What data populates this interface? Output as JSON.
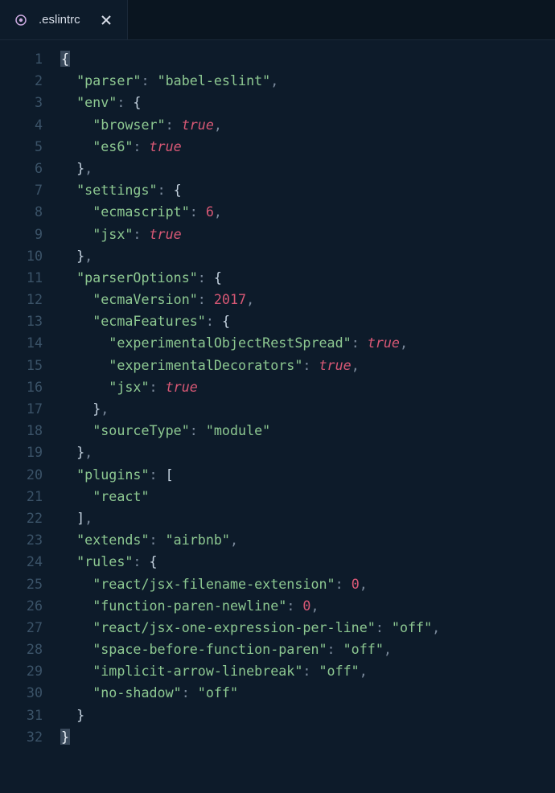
{
  "tab": {
    "filename": ".eslintrc",
    "iconColor": "#d8b8e8"
  },
  "lineNumbers": [
    1,
    2,
    3,
    4,
    5,
    6,
    7,
    8,
    9,
    10,
    11,
    12,
    13,
    14,
    15,
    16,
    17,
    18,
    19,
    20,
    21,
    22,
    23,
    24,
    25,
    26,
    27,
    28,
    29,
    30,
    31,
    32
  ],
  "code": {
    "lines": [
      [
        {
          "t": "brace",
          "v": "{",
          "hl": true
        }
      ],
      [
        {
          "t": "indent",
          "v": "  "
        },
        {
          "t": "key",
          "v": "\"parser\""
        },
        {
          "t": "punc",
          "v": ": "
        },
        {
          "t": "str",
          "v": "\"babel-eslint\""
        },
        {
          "t": "punc",
          "v": ","
        }
      ],
      [
        {
          "t": "indent",
          "v": "  "
        },
        {
          "t": "key",
          "v": "\"env\""
        },
        {
          "t": "punc",
          "v": ": "
        },
        {
          "t": "brace",
          "v": "{"
        }
      ],
      [
        {
          "t": "indent",
          "v": "    "
        },
        {
          "t": "key",
          "v": "\"browser\""
        },
        {
          "t": "punc",
          "v": ": "
        },
        {
          "t": "bool",
          "v": "true"
        },
        {
          "t": "punc",
          "v": ","
        }
      ],
      [
        {
          "t": "indent",
          "v": "    "
        },
        {
          "t": "key",
          "v": "\"es6\""
        },
        {
          "t": "punc",
          "v": ": "
        },
        {
          "t": "bool",
          "v": "true"
        }
      ],
      [
        {
          "t": "indent",
          "v": "  "
        },
        {
          "t": "brace",
          "v": "}"
        },
        {
          "t": "punc",
          "v": ","
        }
      ],
      [
        {
          "t": "indent",
          "v": "  "
        },
        {
          "t": "key",
          "v": "\"settings\""
        },
        {
          "t": "punc",
          "v": ": "
        },
        {
          "t": "brace",
          "v": "{"
        }
      ],
      [
        {
          "t": "indent",
          "v": "    "
        },
        {
          "t": "key",
          "v": "\"ecmascript\""
        },
        {
          "t": "punc",
          "v": ": "
        },
        {
          "t": "num",
          "v": "6"
        },
        {
          "t": "punc",
          "v": ","
        }
      ],
      [
        {
          "t": "indent",
          "v": "    "
        },
        {
          "t": "key",
          "v": "\"jsx\""
        },
        {
          "t": "punc",
          "v": ": "
        },
        {
          "t": "bool",
          "v": "true"
        }
      ],
      [
        {
          "t": "indent",
          "v": "  "
        },
        {
          "t": "brace",
          "v": "}"
        },
        {
          "t": "punc",
          "v": ","
        }
      ],
      [
        {
          "t": "indent",
          "v": "  "
        },
        {
          "t": "key",
          "v": "\"parserOptions\""
        },
        {
          "t": "punc",
          "v": ": "
        },
        {
          "t": "brace",
          "v": "{"
        }
      ],
      [
        {
          "t": "indent",
          "v": "    "
        },
        {
          "t": "key",
          "v": "\"ecmaVersion\""
        },
        {
          "t": "punc",
          "v": ": "
        },
        {
          "t": "num",
          "v": "2017"
        },
        {
          "t": "punc",
          "v": ","
        }
      ],
      [
        {
          "t": "indent",
          "v": "    "
        },
        {
          "t": "key",
          "v": "\"ecmaFeatures\""
        },
        {
          "t": "punc",
          "v": ": "
        },
        {
          "t": "brace",
          "v": "{"
        }
      ],
      [
        {
          "t": "indent",
          "v": "      "
        },
        {
          "t": "key",
          "v": "\"experimentalObjectRestSpread\""
        },
        {
          "t": "punc",
          "v": ": "
        },
        {
          "t": "bool",
          "v": "true"
        },
        {
          "t": "punc",
          "v": ","
        }
      ],
      [
        {
          "t": "indent",
          "v": "      "
        },
        {
          "t": "key",
          "v": "\"experimentalDecorators\""
        },
        {
          "t": "punc",
          "v": ": "
        },
        {
          "t": "bool",
          "v": "true"
        },
        {
          "t": "punc",
          "v": ","
        }
      ],
      [
        {
          "t": "indent",
          "v": "      "
        },
        {
          "t": "key",
          "v": "\"jsx\""
        },
        {
          "t": "punc",
          "v": ": "
        },
        {
          "t": "bool",
          "v": "true"
        }
      ],
      [
        {
          "t": "indent",
          "v": "    "
        },
        {
          "t": "brace",
          "v": "}"
        },
        {
          "t": "punc",
          "v": ","
        }
      ],
      [
        {
          "t": "indent",
          "v": "    "
        },
        {
          "t": "key",
          "v": "\"sourceType\""
        },
        {
          "t": "punc",
          "v": ": "
        },
        {
          "t": "str",
          "v": "\"module\""
        }
      ],
      [
        {
          "t": "indent",
          "v": "  "
        },
        {
          "t": "brace",
          "v": "}"
        },
        {
          "t": "punc",
          "v": ","
        }
      ],
      [
        {
          "t": "indent",
          "v": "  "
        },
        {
          "t": "key",
          "v": "\"plugins\""
        },
        {
          "t": "punc",
          "v": ": "
        },
        {
          "t": "brace",
          "v": "["
        }
      ],
      [
        {
          "t": "indent",
          "v": "    "
        },
        {
          "t": "str",
          "v": "\"react\""
        }
      ],
      [
        {
          "t": "indent",
          "v": "  "
        },
        {
          "t": "brace",
          "v": "]"
        },
        {
          "t": "punc",
          "v": ","
        }
      ],
      [
        {
          "t": "indent",
          "v": "  "
        },
        {
          "t": "key",
          "v": "\"extends\""
        },
        {
          "t": "punc",
          "v": ": "
        },
        {
          "t": "str",
          "v": "\"airbnb\""
        },
        {
          "t": "punc",
          "v": ","
        }
      ],
      [
        {
          "t": "indent",
          "v": "  "
        },
        {
          "t": "key",
          "v": "\"rules\""
        },
        {
          "t": "punc",
          "v": ": "
        },
        {
          "t": "brace",
          "v": "{"
        }
      ],
      [
        {
          "t": "indent",
          "v": "    "
        },
        {
          "t": "key",
          "v": "\"react/jsx-filename-extension\""
        },
        {
          "t": "punc",
          "v": ": "
        },
        {
          "t": "num",
          "v": "0"
        },
        {
          "t": "punc",
          "v": ","
        }
      ],
      [
        {
          "t": "indent",
          "v": "    "
        },
        {
          "t": "key",
          "v": "\"function-paren-newline\""
        },
        {
          "t": "punc",
          "v": ": "
        },
        {
          "t": "num",
          "v": "0"
        },
        {
          "t": "punc",
          "v": ","
        }
      ],
      [
        {
          "t": "indent",
          "v": "    "
        },
        {
          "t": "key",
          "v": "\"react/jsx-one-expression-per-line\""
        },
        {
          "t": "punc",
          "v": ": "
        },
        {
          "t": "str",
          "v": "\"off\""
        },
        {
          "t": "punc",
          "v": ","
        }
      ],
      [
        {
          "t": "indent",
          "v": "    "
        },
        {
          "t": "key",
          "v": "\"space-before-function-paren\""
        },
        {
          "t": "punc",
          "v": ": "
        },
        {
          "t": "str",
          "v": "\"off\""
        },
        {
          "t": "punc",
          "v": ","
        }
      ],
      [
        {
          "t": "indent",
          "v": "    "
        },
        {
          "t": "key",
          "v": "\"implicit-arrow-linebreak\""
        },
        {
          "t": "punc",
          "v": ": "
        },
        {
          "t": "str",
          "v": "\"off\""
        },
        {
          "t": "punc",
          "v": ","
        }
      ],
      [
        {
          "t": "indent",
          "v": "    "
        },
        {
          "t": "key",
          "v": "\"no-shadow\""
        },
        {
          "t": "punc",
          "v": ": "
        },
        {
          "t": "str",
          "v": "\"off\""
        }
      ],
      [
        {
          "t": "indent",
          "v": "  "
        },
        {
          "t": "brace",
          "v": "}"
        }
      ],
      [
        {
          "t": "brace",
          "v": "}",
          "hl": true
        }
      ]
    ]
  }
}
